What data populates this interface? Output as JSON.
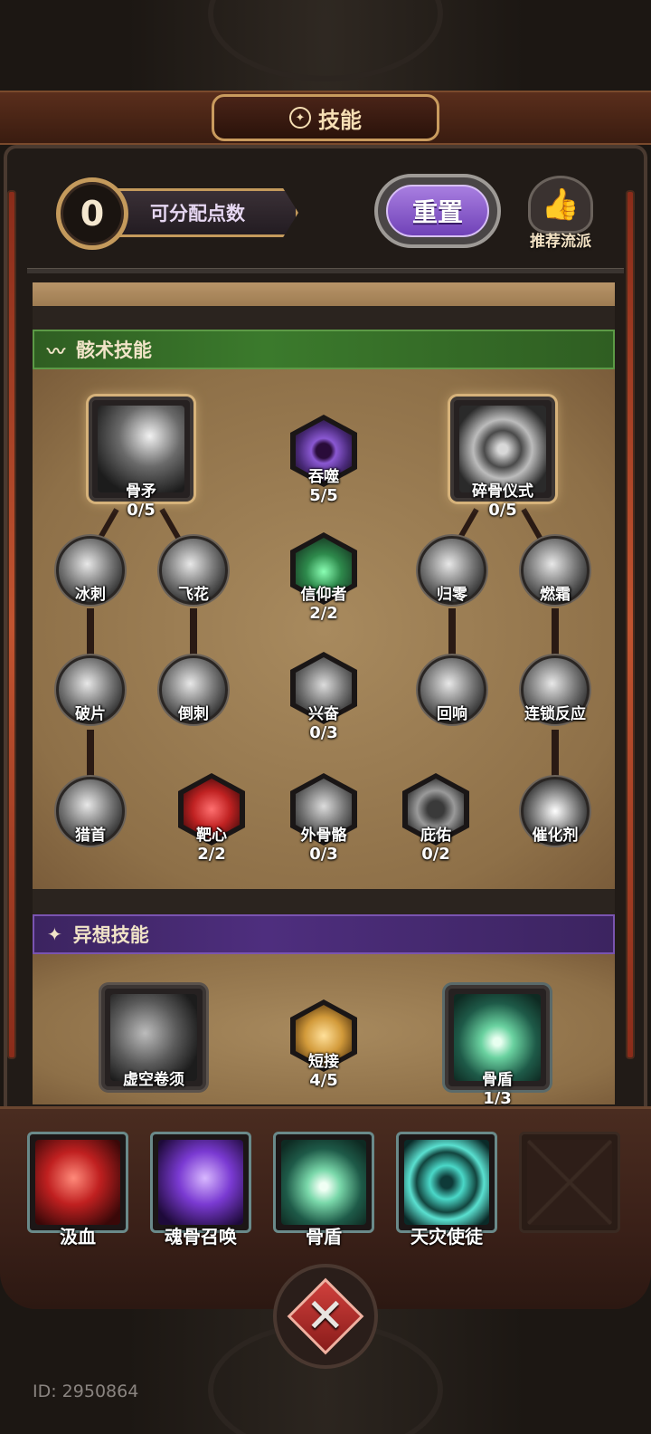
{
  "title": "技能",
  "header": {
    "points_value": "0",
    "points_label": "可分配点数",
    "reset_label": "重置",
    "recommend_label": "推荐流派"
  },
  "sections": {
    "bone": {
      "title": "骸术技能",
      "nodes": {
        "bone_spear": {
          "name": "骨矛",
          "value": "0/5"
        },
        "devour": {
          "name": "吞噬",
          "value": "5/5"
        },
        "bone_ritual": {
          "name": "碎骨仪式",
          "value": "0/5"
        },
        "ice_thorn": {
          "name": "冰刺"
        },
        "flying_flower": {
          "name": "飞花"
        },
        "believer": {
          "name": "信仰者",
          "value": "2/2"
        },
        "return_zero": {
          "name": "归零"
        },
        "burning_frost": {
          "name": "燃霜"
        },
        "fragment": {
          "name": "破片"
        },
        "barb": {
          "name": "倒刺"
        },
        "excitement": {
          "name": "兴奋",
          "value": "0/3"
        },
        "echo": {
          "name": "回响"
        },
        "chain_reaction": {
          "name": "连锁反应"
        },
        "hunting_head": {
          "name": "猎首"
        },
        "bullseye": {
          "name": "靶心",
          "value": "2/2"
        },
        "exoskeleton": {
          "name": "外骨骼",
          "value": "0/3"
        },
        "blessing": {
          "name": "庇佑",
          "value": "0/2"
        },
        "catalyst": {
          "name": "催化剂"
        }
      }
    },
    "fancy": {
      "title": "异想技能",
      "nodes": {
        "void_tendril": {
          "name": "虚空卷须"
        },
        "short_connect": {
          "name": "短接",
          "value": "4/5"
        },
        "bone_shield": {
          "name": "骨盾",
          "value": "1/3"
        }
      }
    }
  },
  "equipped": [
    {
      "name": "汲血"
    },
    {
      "name": "魂骨召唤"
    },
    {
      "name": "骨盾"
    },
    {
      "name": "天灾使徒"
    }
  ],
  "id_text": "ID: 2950864"
}
